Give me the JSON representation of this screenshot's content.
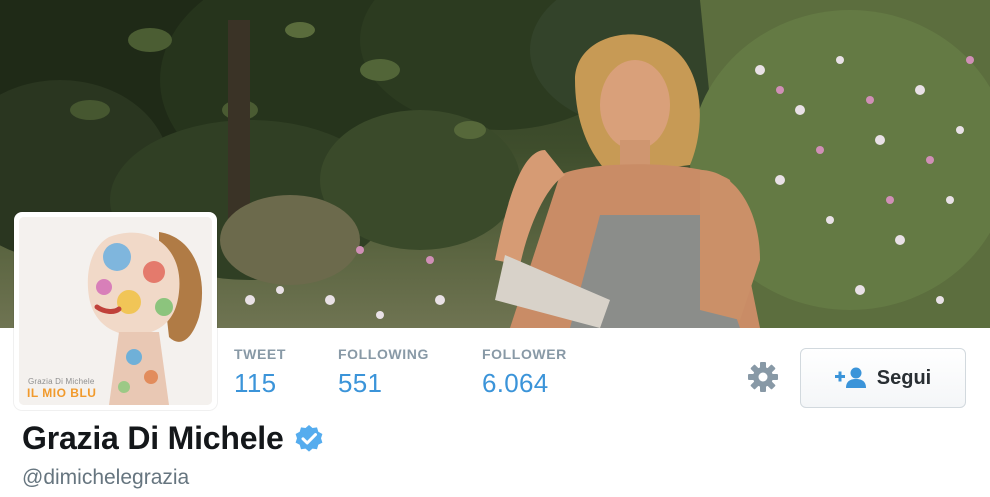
{
  "profile": {
    "name": "Grazia Di Michele",
    "screen_name": "@dimichelegrazia",
    "verified": true,
    "avatar_album_credit": "Grazia Di Michele",
    "avatar_album_title": "IL MIO BLU"
  },
  "stats": [
    {
      "label": "TWEET",
      "value": "115"
    },
    {
      "label": "FOLLOWING",
      "value": "551"
    },
    {
      "label": "FOLLOWER",
      "value": "6.064"
    }
  ],
  "actions": {
    "follow_label": "Segui",
    "follow_icon": "add-user-icon",
    "settings_icon": "gear-icon"
  },
  "colors": {
    "link_blue": "#3b94d9",
    "verified_blue": "#55acee",
    "label_gray": "#8899a6",
    "name_dark": "#14171a",
    "album_orange": "#f19a2c"
  }
}
